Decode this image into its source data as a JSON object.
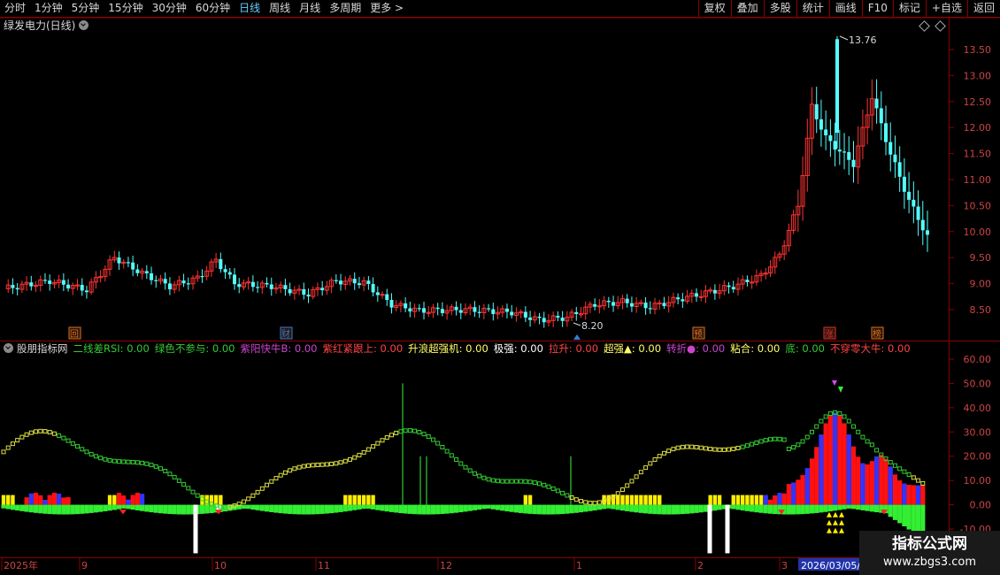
{
  "toolbar": {
    "left": [
      "分时",
      "1分钟",
      "5分钟",
      "15分钟",
      "30分钟",
      "60分钟",
      "日线",
      "周线",
      "月线",
      "多周期",
      "更多"
    ],
    "active_index": 6,
    "more_arrow": ">",
    "right": [
      "复权",
      "叠加",
      "多股",
      "统计",
      "画线",
      "F10",
      "标记",
      "+自选",
      "返回"
    ]
  },
  "kline": {
    "title": "绿发电力(日线)",
    "high_label": "13.76",
    "low_label": "8.20",
    "price_ticks": [
      "13.50",
      "13.00",
      "12.50",
      "12.00",
      "11.50",
      "11.00",
      "10.50",
      "10.00",
      "9.50",
      "9.00",
      "8.50"
    ],
    "event_markers": [
      {
        "label": "回",
        "color": "#e07020"
      },
      {
        "label": "财",
        "color": "#3a7bd5"
      },
      {
        "label": "预",
        "color": "#e07020"
      },
      {
        "label": "涨",
        "color": "#e03030"
      },
      {
        "label": "榜",
        "color": "#e07020"
      }
    ]
  },
  "indicator": {
    "name": "股朋指标网",
    "items": [
      {
        "label": "二线差RSI: ",
        "value": "0.00",
        "color": "#33cc33"
      },
      {
        "label": "绿色不参与: ",
        "value": "0.00",
        "color": "#33cc33"
      },
      {
        "label": "紫阳快牛B: ",
        "value": "0.00",
        "color": "#cc44cc"
      },
      {
        "label": "紫红紧跟上: ",
        "value": "0.00",
        "color": "#ff4444"
      },
      {
        "label": "升浪超强机: ",
        "value": "0.00",
        "color": "#ffff66"
      },
      {
        "label": "极强: ",
        "value": "0.00",
        "color": "#ffffff"
      },
      {
        "label": "拉升: ",
        "value": "0.00",
        "color": "#ff4444"
      },
      {
        "label": "超强▲: ",
        "value": "0.00",
        "color": "#ffff66"
      },
      {
        "label": "转折●: ",
        "value": "0.00",
        "color": "#cc44cc"
      },
      {
        "label": "粘合: ",
        "value": "0.00",
        "color": "#ffff66"
      },
      {
        "label": "底: ",
        "value": "0.00",
        "color": "#33cc33"
      },
      {
        "label": "不穿零大牛: ",
        "value": "0.00",
        "color": "#ff4444"
      }
    ],
    "ticks": [
      "60.00",
      "50.00",
      "40.00",
      "30.00",
      "20.00",
      "10.00",
      "0.00",
      "-10.00"
    ]
  },
  "xaxis": {
    "labels": [
      "2025年",
      "9",
      "10",
      "11",
      "12",
      "1",
      "2",
      "3"
    ],
    "cursor_date": "2026/03/05/"
  },
  "watermark": {
    "line1": "指标公式网",
    "line2": "www.zbgs3.com"
  },
  "colors": {
    "up": "#ff3333",
    "down": "#54ffff",
    "border": "#8b0000",
    "axis_text": "#cc4444"
  }
}
